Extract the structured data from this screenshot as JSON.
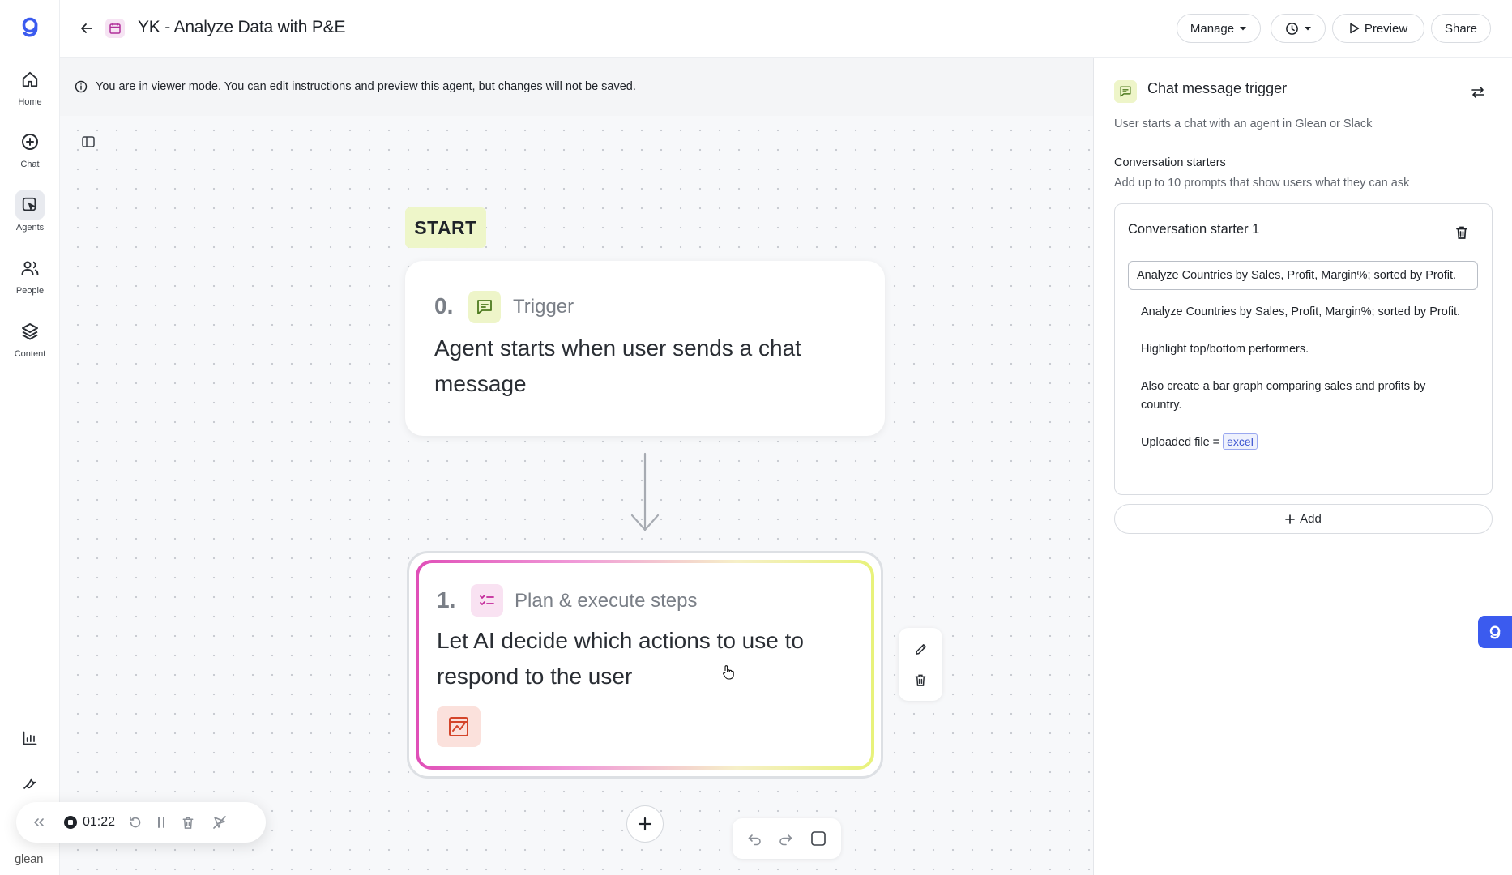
{
  "brand": {
    "wordmark": "glean",
    "accent": "#3b5bef"
  },
  "nav": {
    "items": [
      {
        "label": "Home",
        "icon": "home-icon"
      },
      {
        "label": "Chat",
        "icon": "chat-plus-icon"
      },
      {
        "label": "Agents",
        "icon": "agents-icon"
      },
      {
        "label": "People",
        "icon": "people-icon"
      },
      {
        "label": "Content",
        "icon": "layers-icon"
      }
    ],
    "active": "Agents"
  },
  "header": {
    "title": "YK - Analyze Data with P&E",
    "manage_label": "Manage",
    "preview_label": "Preview",
    "share_label": "Share"
  },
  "banner": {
    "text": "You are in viewer mode. You can edit instructions and preview this agent, but changes will not be saved."
  },
  "canvas": {
    "start_label": "START",
    "steps": [
      {
        "number": "0.",
        "type": "Trigger",
        "description": "Agent starts when user sends a chat message"
      },
      {
        "number": "1.",
        "type": "Plan & execute steps",
        "description": "Let AI decide which actions to use to respond to the user"
      }
    ]
  },
  "recorder": {
    "time": "01:22"
  },
  "panel": {
    "title": "Chat message trigger",
    "subtitle": "User starts a chat with an agent in Glean or Slack",
    "section_title": "Conversation starters",
    "section_subtitle": "Add up to 10 prompts that show users what they can ask",
    "starter": {
      "title": "Conversation starter 1",
      "input_value": "Analyze Countries by Sales, Profit, Margin%; sorted by Profit.",
      "lines": [
        "Analyze Countries by Sales, Profit, Margin%; sorted by Profit.",
        "Highlight top/bottom performers.",
        "Also create a bar graph comparing sales and profits by country."
      ],
      "upload_label": "Uploaded file =",
      "upload_tag": "excel"
    },
    "add_label": "Add"
  }
}
